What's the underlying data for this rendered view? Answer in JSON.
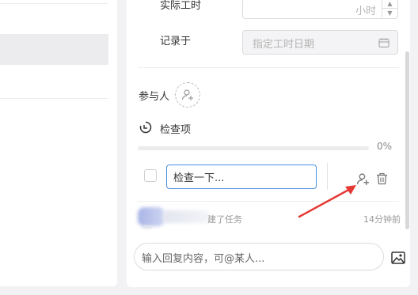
{
  "form": {
    "actual_hours_label": "实际工时",
    "actual_hours_placeholder": "小时",
    "record_label": "记录于",
    "record_date_placeholder": "指定工时日期"
  },
  "participants": {
    "label": "参与人"
  },
  "checklist": {
    "title": "检查项",
    "progress_text": "0%",
    "progress_value": 0,
    "item_value": "检查一下..."
  },
  "activity": {
    "action_text": "建了任务",
    "time": "14分钟前"
  },
  "reply": {
    "placeholder": "输入回复内容，可@某人..."
  },
  "colors": {
    "accent": "#4a90e2",
    "annotation_arrow": "#e53935"
  },
  "icons": {
    "calendar": "calendar-icon",
    "add_user": "add-user-icon",
    "checklist": "checklist-clock-icon",
    "delete": "trash-icon",
    "image": "image-icon"
  }
}
